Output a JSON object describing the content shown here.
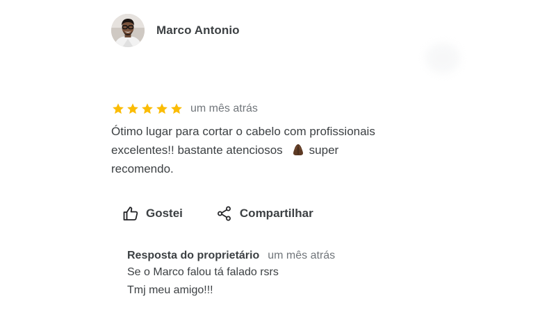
{
  "review": {
    "author": {
      "name": "Marco Antonio",
      "avatar_icon": "user-photo-avatar"
    },
    "rating": 5,
    "rating_max": 5,
    "star_color": "#fbbc04",
    "time": "um mês atrás",
    "text_lines": [
      "Ótimo lugar para cortar o cabelo com profissionais",
      "excelentes!! bastante atenciosos",
      "super",
      "recomendo."
    ],
    "emoji_icon": "praying-hands-emoji"
  },
  "actions": {
    "like": {
      "label": "Gostei",
      "icon": "thumbs-up-icon"
    },
    "share": {
      "label": "Compartilhar",
      "icon": "share-icon"
    }
  },
  "owner_response": {
    "title": "Resposta do proprietário",
    "time": "um mês atrás",
    "lines": [
      "Se o Marco falou tá falado rsrs",
      "Tmj meu amigo!!!"
    ]
  }
}
